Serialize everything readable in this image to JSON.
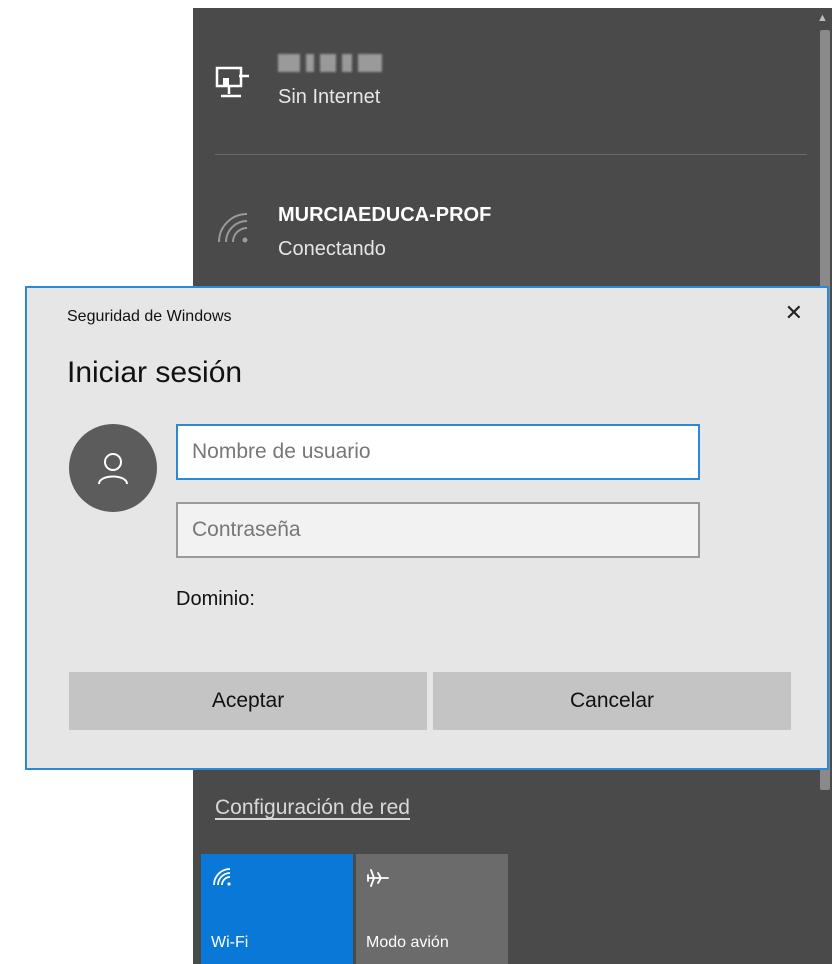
{
  "flyout": {
    "networks": [
      {
        "name": "",
        "status": "Sin Internet",
        "icon": "ethernet-icon"
      },
      {
        "name": "MURCIAEDUCA-PROF",
        "status": "Conectando",
        "icon": "wifi-icon"
      }
    ],
    "settings_link": "Configuración de red",
    "quick_actions": [
      {
        "label": "Wi-Fi",
        "icon": "wifi-icon",
        "active": true,
        "color": "#0a78d7"
      },
      {
        "label": "Modo avión",
        "icon": "airplane-icon",
        "active": false,
        "color": "#6b6b6b"
      }
    ]
  },
  "dialog": {
    "window_title": "Seguridad de Windows",
    "heading": "Iniciar sesión",
    "username_placeholder": "Nombre de usuario",
    "password_placeholder": "Contraseña",
    "domain_label": "Dominio:",
    "ok_button": "Aceptar",
    "cancel_button": "Cancelar",
    "accent_color": "#2b8ad8"
  }
}
